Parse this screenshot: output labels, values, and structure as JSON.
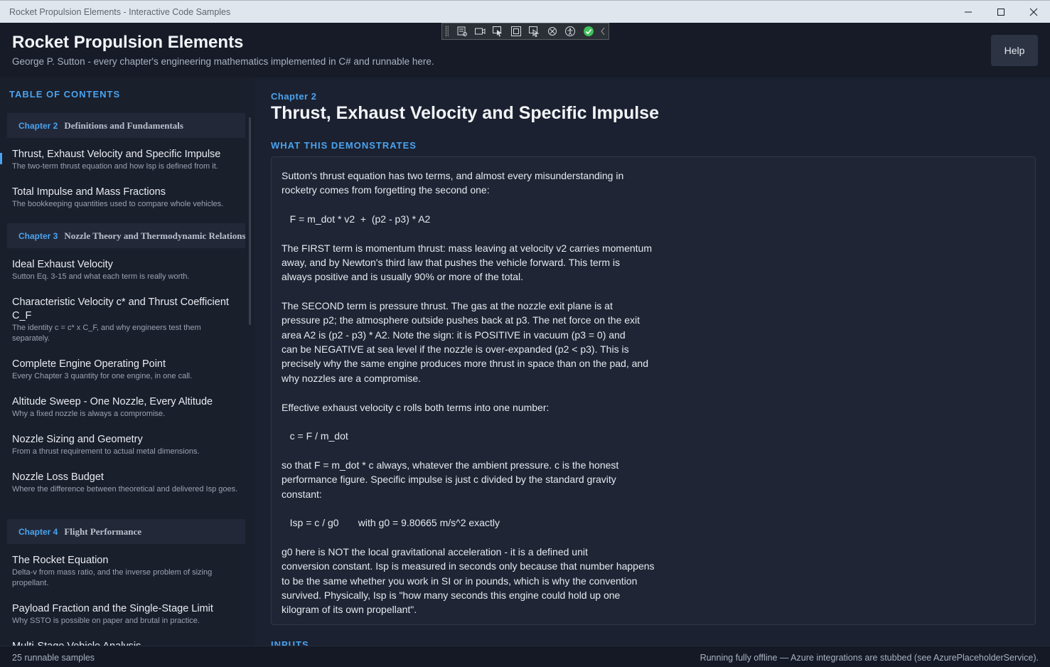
{
  "window": {
    "title": "Rocket Propulsion Elements - Interactive Code Samples"
  },
  "header": {
    "title": "Rocket Propulsion Elements",
    "subtitle": "George P. Sutton - every chapter's engineering mathematics implemented in C# and runnable here.",
    "help_label": "Help"
  },
  "toc": {
    "heading": "TABLE OF CONTENTS",
    "chapters": [
      {
        "number": "Chapter 2",
        "name": "Definitions and Fundamentals",
        "items": [
          {
            "title": "Thrust, Exhaust Velocity and Specific Impulse",
            "desc": "The two-term thrust equation and how Isp is defined from it."
          },
          {
            "title": "Total Impulse and Mass Fractions",
            "desc": "The bookkeeping quantities used to compare whole vehicles."
          }
        ]
      },
      {
        "number": "Chapter 3",
        "name": "Nozzle Theory and Thermodynamic Relations",
        "items": [
          {
            "title": "Ideal Exhaust Velocity",
            "desc": "Sutton Eq. 3-15 and what each term is really worth."
          },
          {
            "title": "Characteristic Velocity c* and Thrust Coefficient C_F",
            "desc": "The identity c = c* x C_F, and why engineers test them separately."
          },
          {
            "title": "Complete Engine Operating Point",
            "desc": "Every Chapter 3 quantity for one engine, in one call."
          },
          {
            "title": "Altitude Sweep - One Nozzle, Every Altitude",
            "desc": "Why a fixed nozzle is always a compromise."
          },
          {
            "title": "Nozzle Sizing and Geometry",
            "desc": "From a thrust requirement to actual metal dimensions."
          },
          {
            "title": "Nozzle Loss Budget",
            "desc": "Where the difference between theoretical and delivered Isp goes."
          }
        ]
      },
      {
        "number": "Chapter 4",
        "name": "Flight Performance",
        "items": [
          {
            "title": "The Rocket Equation",
            "desc": "Delta-v from mass ratio, and the inverse problem of sizing propellant."
          },
          {
            "title": "Payload Fraction and the Single-Stage Limit",
            "desc": "Why SSTO is possible on paper and brutal in practice."
          },
          {
            "title": "Multi-Stage Vehicle Analysis",
            "desc": ""
          }
        ]
      }
    ]
  },
  "main": {
    "chapter_label": "Chapter 2",
    "title": "Thrust, Exhaust Velocity and Specific Impulse",
    "demo_heading": "WHAT THIS DEMONSTRATES",
    "demo_text": "Sutton's thrust equation has two terms, and almost every misunderstanding in\nrocketry comes from forgetting the second one:\n\n   F = m_dot * v2  +  (p2 - p3) * A2\n\nThe FIRST term is momentum thrust: mass leaving at velocity v2 carries momentum\naway, and by Newton's third law that pushes the vehicle forward. This term is\nalways positive and is usually 90% or more of the total.\n\nThe SECOND term is pressure thrust. The gas at the nozzle exit plane is at\npressure p2; the atmosphere outside pushes back at p3. The net force on the exit\narea A2 is (p2 - p3) * A2. Note the sign: it is POSITIVE in vacuum (p3 = 0) and\ncan be NEGATIVE at sea level if the nozzle is over-expanded (p2 < p3). This is\nprecisely why the same engine produces more thrust in space than on the pad, and\nwhy nozzles are a compromise.\n\nEffective exhaust velocity c rolls both terms into one number:\n\n   c = F / m_dot\n\nso that F = m_dot * c always, whatever the ambient pressure. c is the honest\nperformance figure. Specific impulse is just c divided by the standard gravity\nconstant:\n\n   Isp = c / g0       with g0 = 9.80665 m/s^2 exactly\n\ng0 here is NOT the local gravitational acceleration - it is a defined unit\nconversion constant. Isp is measured in seconds only because that number happens\nto be the same whether you work in SI or in pounds, which is why the convention\nsurvived. Physically, Isp is \"how many seconds this engine could hold up one\nkilogram of its own propellant\".",
    "inputs_heading": "INPUTS"
  },
  "status": {
    "left": "25 runnable samples",
    "right": "Running fully offline — Azure integrations are stubbed (see AzurePlaceholderService)."
  },
  "colors": {
    "accent": "#4aa3ef",
    "background": "#1b2130",
    "sidebar": "#1a1f2c",
    "header": "#161b27"
  },
  "icons": {
    "window_controls": [
      "minimize-icon",
      "maximize-icon",
      "close-icon"
    ],
    "devbar": [
      "visual-tree-icon",
      "record-icon",
      "select-element-icon",
      "display-layout-adorners-icon",
      "track-focus-icon",
      "hot-reload-icon",
      "accessibility-icon",
      "binding-ok-icon",
      "collapse-chevron-icon"
    ]
  }
}
